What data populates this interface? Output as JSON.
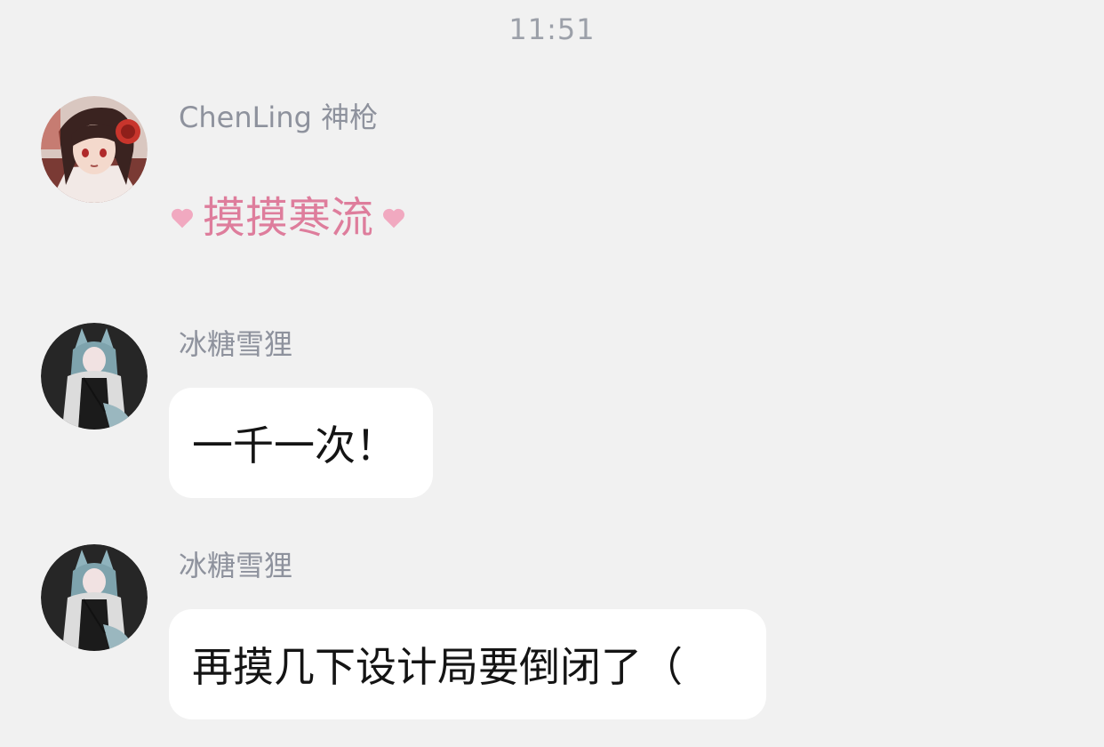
{
  "timestamp": "11:51",
  "messages": [
    {
      "sender": "ChenLing 神枪",
      "type": "poke",
      "text": "摸摸寒流",
      "avatar_icon": "avatar-anime-red-headphones"
    },
    {
      "sender": "冰糖雪狸",
      "type": "text",
      "text": "一千一次！",
      "avatar_icon": "avatar-anime-fox-girl"
    },
    {
      "sender": "冰糖雪狸",
      "type": "text",
      "text": "再摸几下设计局要倒闭了（",
      "avatar_icon": "avatar-anime-fox-girl"
    }
  ],
  "colors": {
    "background": "#f1f1f1",
    "sender_name": "#8e929d",
    "timestamp": "#9ca0a9",
    "poke_pink": "#de7d9c",
    "heart_pink": "#f1a9c0",
    "bubble": "#ffffff",
    "message_text": "#141414"
  }
}
